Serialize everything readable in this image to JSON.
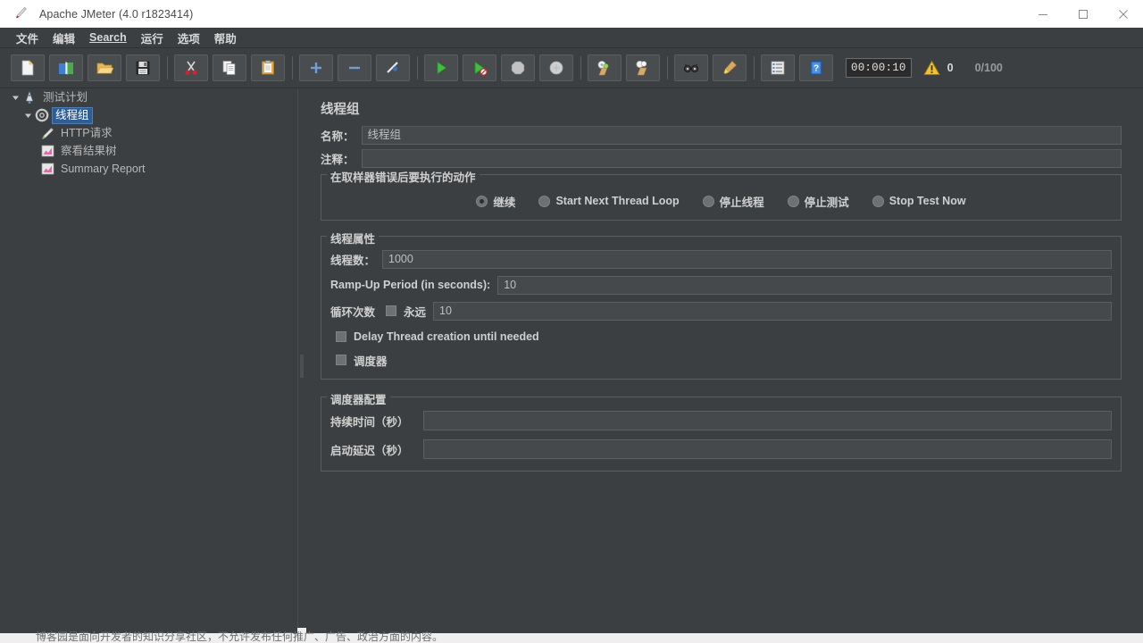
{
  "window": {
    "title": "Apache JMeter (4.0 r1823414)",
    "app_icon": "jmeter-feather-icon",
    "minimize_label": "—",
    "maximize_label": "□",
    "close_label": "✕"
  },
  "menubar": {
    "items": [
      {
        "label": "文件",
        "mnemonic": ""
      },
      {
        "label": "编辑",
        "mnemonic": ""
      },
      {
        "label": "Search",
        "mnemonic": "S"
      },
      {
        "label": "运行",
        "mnemonic": ""
      },
      {
        "label": "选项",
        "mnemonic": ""
      },
      {
        "label": "帮助",
        "mnemonic": ""
      }
    ]
  },
  "toolbar": {
    "buttons": [
      {
        "name": "new-icon"
      },
      {
        "name": "templates-icon"
      },
      {
        "name": "open-icon"
      },
      {
        "name": "save-icon"
      },
      {
        "name": "cut-icon"
      },
      {
        "name": "copy-icon"
      },
      {
        "name": "paste-icon"
      },
      {
        "name": "expand-all-icon"
      },
      {
        "name": "collapse-all-icon"
      },
      {
        "name": "toggle-icon"
      },
      {
        "name": "start-icon"
      },
      {
        "name": "start-no-pauses-icon"
      },
      {
        "name": "stop-icon"
      },
      {
        "name": "shutdown-icon"
      },
      {
        "name": "clear-icon"
      },
      {
        "name": "clear-all-icon"
      },
      {
        "name": "search-icon"
      },
      {
        "name": "search-reset-icon"
      },
      {
        "name": "function-helper-icon"
      },
      {
        "name": "help-icon"
      }
    ],
    "timer": "00:00:10",
    "warning_count": "0",
    "thread_counter": "0/100"
  },
  "tree": {
    "nodes": [
      {
        "label": "测试计划",
        "icon": "test-plan-icon",
        "indent": 1,
        "expanded": true,
        "selected": false,
        "name": "tree-node-test-plan"
      },
      {
        "label": "线程组",
        "icon": "thread-group-icon",
        "indent": 2,
        "expanded": true,
        "selected": true,
        "name": "tree-node-thread-group"
      },
      {
        "label": "HTTP请求",
        "icon": "http-request-icon",
        "indent": 3,
        "expanded": null,
        "selected": false,
        "name": "tree-node-http-request"
      },
      {
        "label": "察看结果树",
        "icon": "view-results-tree-icon",
        "indent": 3,
        "expanded": null,
        "selected": false,
        "name": "tree-node-view-results-tree"
      },
      {
        "label": "Summary Report",
        "icon": "summary-report-icon",
        "indent": 3,
        "expanded": null,
        "selected": false,
        "name": "tree-node-summary-report"
      }
    ]
  },
  "main": {
    "panel_title": "线程组",
    "name_label": "名称：",
    "name_value": "线程组",
    "comment_label": "注释：",
    "comment_value": "",
    "on_error": {
      "group_title": "在取样器错误后要执行的动作",
      "options": [
        {
          "label": "继续",
          "checked": true,
          "name": "radio-continue"
        },
        {
          "label": "Start Next Thread Loop",
          "checked": false,
          "name": "radio-start-next-thread-loop"
        },
        {
          "label": "停止线程",
          "checked": false,
          "name": "radio-stop-thread"
        },
        {
          "label": "停止测试",
          "checked": false,
          "name": "radio-stop-test"
        },
        {
          "label": "Stop Test Now",
          "checked": false,
          "name": "radio-stop-test-now"
        }
      ]
    },
    "thread_props": {
      "group_title": "线程属性",
      "num_threads_label": "线程数：",
      "num_threads_value": "1000",
      "ramp_up_label": "Ramp-Up Period (in seconds):",
      "ramp_up_value": "10",
      "loop_count_label": "循环次数",
      "forever_label": "永远",
      "forever_checked": false,
      "loop_count_value": "10",
      "delay_thread_label": "Delay Thread creation until needed",
      "delay_thread_checked": false,
      "scheduler_label": "调度器",
      "scheduler_checked": false
    },
    "scheduler_config": {
      "group_title": "调度器配置",
      "duration_label": "持续时间（秒）",
      "duration_value": "",
      "startup_delay_label": "启动延迟（秒）",
      "startup_delay_value": ""
    }
  },
  "bottom": {
    "watermark": "博客园是面向开发者的知识分享社区，不允许发布任何推广、广告、政治方面的内容。"
  },
  "colors": {
    "window_bg": "#3c3f41",
    "selection": "#2f5d94",
    "input_bg": "#45494b",
    "text": "#d0d0d0"
  }
}
